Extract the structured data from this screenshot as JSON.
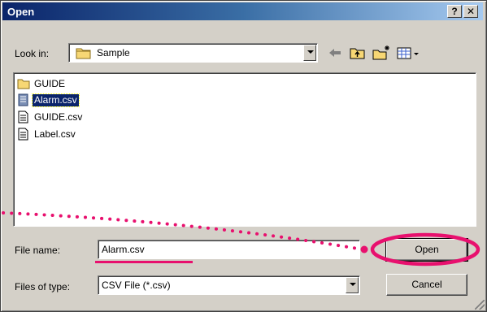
{
  "window": {
    "title": "Open",
    "help_label": "?",
    "close_label": "✕"
  },
  "look_in": {
    "label": "Look in:",
    "value": "Sample"
  },
  "toolbar": {
    "icons": [
      "back-arrow-icon",
      "up-folder-icon",
      "new-folder-icon",
      "view-menu-icon"
    ]
  },
  "files": [
    {
      "name": "GUIDE",
      "icon": "folder-icon",
      "selected": false
    },
    {
      "name": "Alarm.csv",
      "icon": "csv-file-icon",
      "selected": true
    },
    {
      "name": "GUIDE.csv",
      "icon": "text-file-icon",
      "selected": false
    },
    {
      "name": "Label.csv",
      "icon": "text-file-icon",
      "selected": false
    }
  ],
  "file_name": {
    "label": "File name:",
    "value": "Alarm.csv"
  },
  "file_type": {
    "label": "Files of type:",
    "value": "CSV File (*.csv)"
  },
  "buttons": {
    "open_label": "Open",
    "cancel_label": "Cancel"
  },
  "colors": {
    "annotation": "#e8106e",
    "title_bar": "#0a246a",
    "selection": "#0a246a"
  }
}
